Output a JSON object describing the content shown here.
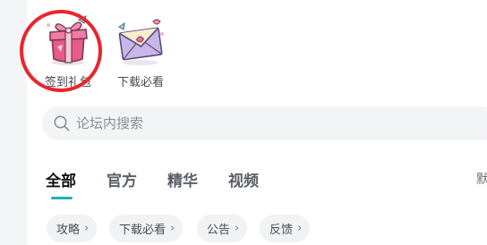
{
  "shortcuts": [
    {
      "label": "签到礼包",
      "icon": "gift-box-icon"
    },
    {
      "label": "下载必看",
      "icon": "envelope-icon"
    }
  ],
  "search": {
    "placeholder": "论坛内搜索",
    "value": ""
  },
  "tabs": [
    {
      "label": "全部",
      "active": true
    },
    {
      "label": "官方",
      "active": false
    },
    {
      "label": "精华",
      "active": false
    },
    {
      "label": "视频",
      "active": false
    }
  ],
  "sort": {
    "label": "默"
  },
  "chips": [
    {
      "label": "攻略"
    },
    {
      "label": "下载必看"
    },
    {
      "label": "公告"
    },
    {
      "label": "反馈"
    }
  ],
  "colors": {
    "accent": "#1bb5b0",
    "annotation_circle": "#e8262c",
    "search_bg": "#f3f4f6",
    "chip_bg": "#f1f2f4"
  }
}
